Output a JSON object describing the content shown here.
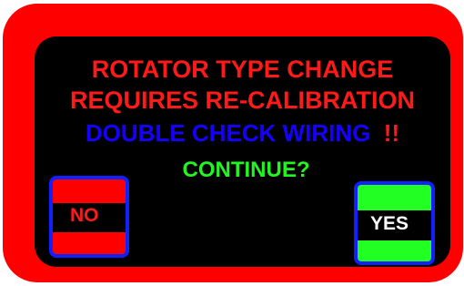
{
  "dialog": {
    "line1": "ROTATOR TYPE CHANGE",
    "line2": "REQUIRES RE-CALIBRATION",
    "line3_main": "DOUBLE CHECK WIRING",
    "line3_bang": "!!",
    "prompt": "CONTINUE?"
  },
  "buttons": {
    "no_label": "NO",
    "yes_label": "YES"
  },
  "colors": {
    "frame": "#fe0000",
    "screen": "#000000",
    "warning_text": "#ff1a1a",
    "wiring_text": "#1500ff",
    "prompt_text": "#23f523",
    "button_border": "#1020ff",
    "yes_button": "#22ff22",
    "no_button": "#fe0000"
  }
}
